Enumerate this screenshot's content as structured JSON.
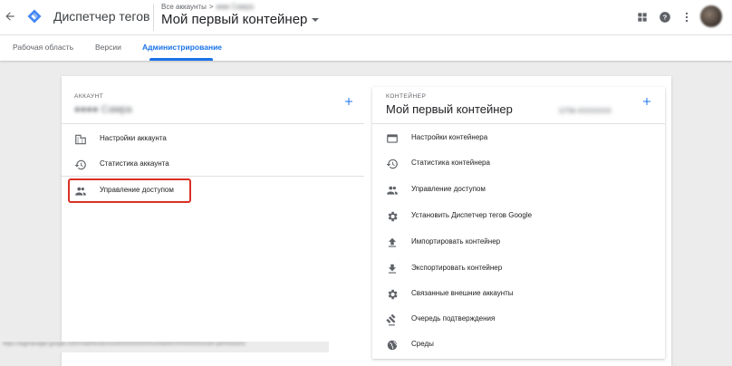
{
  "header": {
    "product_name": "Диспетчер тегов",
    "breadcrumb_all_accounts": "Все аккаунты",
    "breadcrumb_separator": ">",
    "breadcrumb_account_obscured": "●●● Самра",
    "container_title": "Мой первый контейнер"
  },
  "tabs": [
    {
      "label": "Рабочая область",
      "active": false
    },
    {
      "label": "Версии",
      "active": false
    },
    {
      "label": "Администрирование",
      "active": true
    }
  ],
  "account_section": {
    "label": "АККАУНТ",
    "name_obscured": "●●●● Самра",
    "items": [
      {
        "label": "Настройки аккаунта",
        "icon": "building-icon"
      },
      {
        "label": "Статистика аккаунта",
        "icon": "history-icon"
      },
      {
        "label": "Управление доступом",
        "icon": "people-icon",
        "highlighted": true
      }
    ]
  },
  "container_section": {
    "label": "КОНТЕЙНЕР",
    "title": "Мой первый контейнер",
    "id_obscured": "GTM-XXXXXXX",
    "items": [
      {
        "label": "Настройки контейнера",
        "icon": "web-icon"
      },
      {
        "label": "Статистика контейнера",
        "icon": "history-icon"
      },
      {
        "label": "Управление доступом",
        "icon": "people-icon"
      },
      {
        "label": "Установить Диспетчер тегов Google",
        "icon": "gear-icon"
      },
      {
        "label": "Импортировать контейнер",
        "icon": "upload-icon"
      },
      {
        "label": "Экспортировать контейнер",
        "icon": "download-icon"
      },
      {
        "label": "Связанные внешние аккаунты",
        "icon": "gear-icon"
      },
      {
        "label": "Очередь подтверждения",
        "icon": "gavel-icon"
      },
      {
        "label": "Среды",
        "icon": "globe-icon"
      }
    ]
  },
  "status_bar": {
    "url_obscured": "https://tagmanager.google.com/#/admin/accounts/000000000/containers/00000000/user-permissions"
  },
  "colors": {
    "accent": "#1a73e8",
    "highlight": "#d93025",
    "page_bg": "#ececec"
  }
}
